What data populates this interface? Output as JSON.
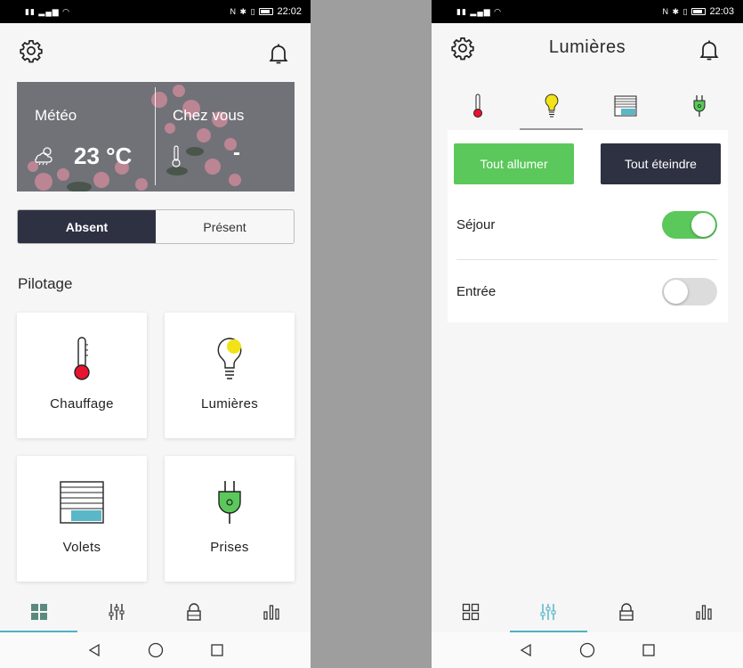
{
  "left_screen": {
    "status": {
      "time": "22:02"
    },
    "weather": {
      "title": "Météo",
      "temperature": "23 °C",
      "home_title": "Chez vous",
      "home_value": "-"
    },
    "mode": {
      "options": [
        "Absent",
        "Présent"
      ],
      "selected": "Absent"
    },
    "section_title": "Pilotage",
    "tiles": [
      {
        "label": "Chauffage",
        "icon": "thermometer-icon"
      },
      {
        "label": "Lumières",
        "icon": "lightbulb-icon"
      },
      {
        "label": "Volets",
        "icon": "shutter-icon"
      },
      {
        "label": "Prises",
        "icon": "plug-icon"
      }
    ],
    "bottom_nav": [
      "dashboard-icon",
      "sliders-icon",
      "lock-icon",
      "bar-chart-icon"
    ],
    "active_nav": "dashboard-icon"
  },
  "right_screen": {
    "status": {
      "time": "22:03"
    },
    "title": "Lumières",
    "category_tabs": [
      "thermometer-icon",
      "lightbulb-icon",
      "shutter-icon",
      "plug-icon"
    ],
    "active_tab": "lightbulb-icon",
    "all_on_label": "Tout allumer",
    "all_off_label": "Tout éteindre",
    "rooms": [
      {
        "name": "Séjour",
        "on": true
      },
      {
        "name": "Entrée",
        "on": false
      }
    ],
    "bottom_nav": [
      "dashboard-icon",
      "sliders-icon",
      "lock-icon",
      "bar-chart-icon"
    ],
    "active_nav": "sliders-icon"
  },
  "colors": {
    "accent_green": "#5ac85a",
    "dark_navy": "#2d3142",
    "teal_active": "#4fb2c4",
    "bulb_yellow": "#f2e318",
    "thermo_red": "#e8132f"
  }
}
